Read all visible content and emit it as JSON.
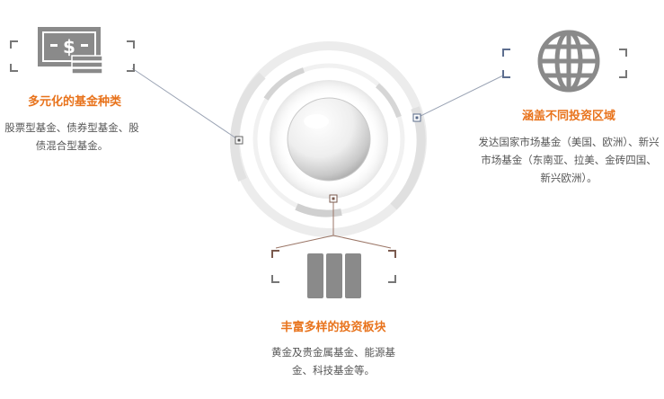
{
  "features": {
    "left": {
      "icon": "money-icon",
      "title": "多元化的基金种类",
      "description": "股票型基金、债券型基金、股债混合型基金。"
    },
    "right": {
      "icon": "globe-icon",
      "title": "涵盖不同投资区域",
      "description": "发达国家市场基金（美国、欧洲）、新兴市场基金（东南亚、拉美、金砖四国、新兴欧洲）。"
    },
    "bottom": {
      "icon": "columns-icon",
      "title": "丰富多样的投资板块",
      "description": "黄金及贵金属基金、能源基金、科技基金等。"
    }
  },
  "colors": {
    "accent": "#e8731c",
    "icon_gray": "#8a8a8a",
    "text_gray": "#555555"
  }
}
